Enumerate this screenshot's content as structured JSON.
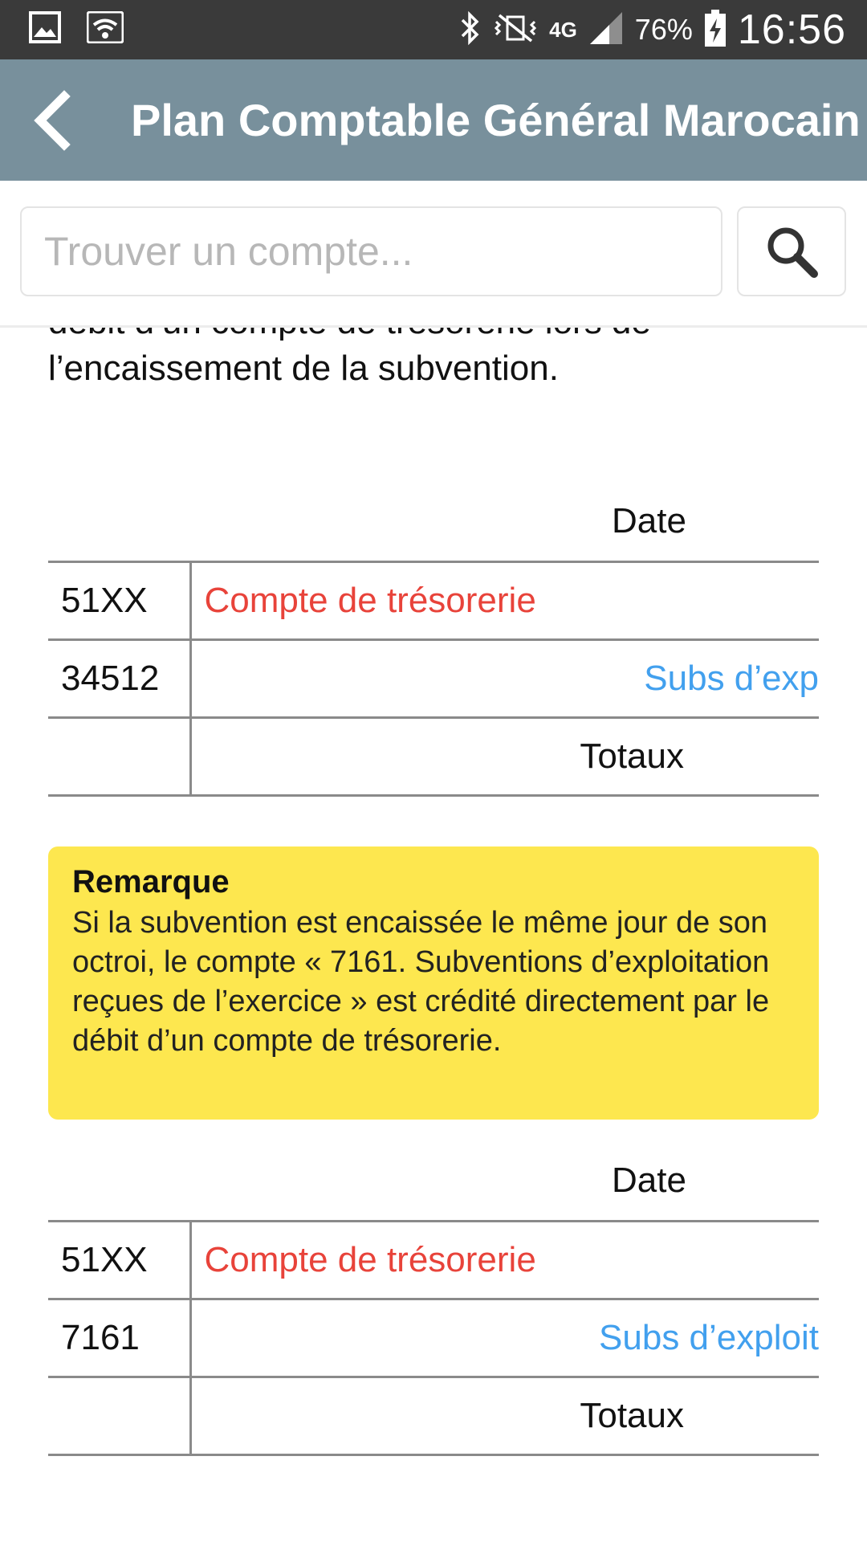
{
  "status_bar": {
    "battery": "76%",
    "network": "4G",
    "time": "16:56",
    "icons": [
      "gallery-icon",
      "wifi-icon",
      "bluetooth-icon",
      "vibrate-icon",
      "signal-icon",
      "battery-charging-icon"
    ]
  },
  "app_bar": {
    "title": "Plan Comptable Général Marocain",
    "back_icon": "chevron-left-icon",
    "background": "#78909c"
  },
  "search": {
    "placeholder": "Trouver un compte...",
    "value": "",
    "icon": "search-icon"
  },
  "content": {
    "intro_text": "débit d’un compte de trésorerie lors de l’encaissement de la subvention.",
    "entry1": {
      "date_label": "Date",
      "rows": [
        {
          "account": "51XX",
          "label": "Compte de trésorerie"
        },
        {
          "account": "34512",
          "label": "Subs d’exp"
        },
        {
          "account": "",
          "label": "Totaux"
        }
      ]
    },
    "note": {
      "title": "Remarque",
      "body": "Si la subvention est encaissée le même jour de son octroi, le compte « 7161. Subventions d’exploitation reçues de l’exercice » est crédité directement par le débit d’un compte de trésorerie."
    },
    "entry2": {
      "date_label": "Date",
      "rows": [
        {
          "account": "51XX",
          "label": "Compte de trésorerie"
        },
        {
          "account": "7161",
          "label": "Subs d’exploit"
        },
        {
          "account": "",
          "label": "Totaux"
        }
      ]
    }
  },
  "colors": {
    "debit": "#e8433a",
    "credit": "#42a0ee",
    "note_background": "#fde74f"
  }
}
